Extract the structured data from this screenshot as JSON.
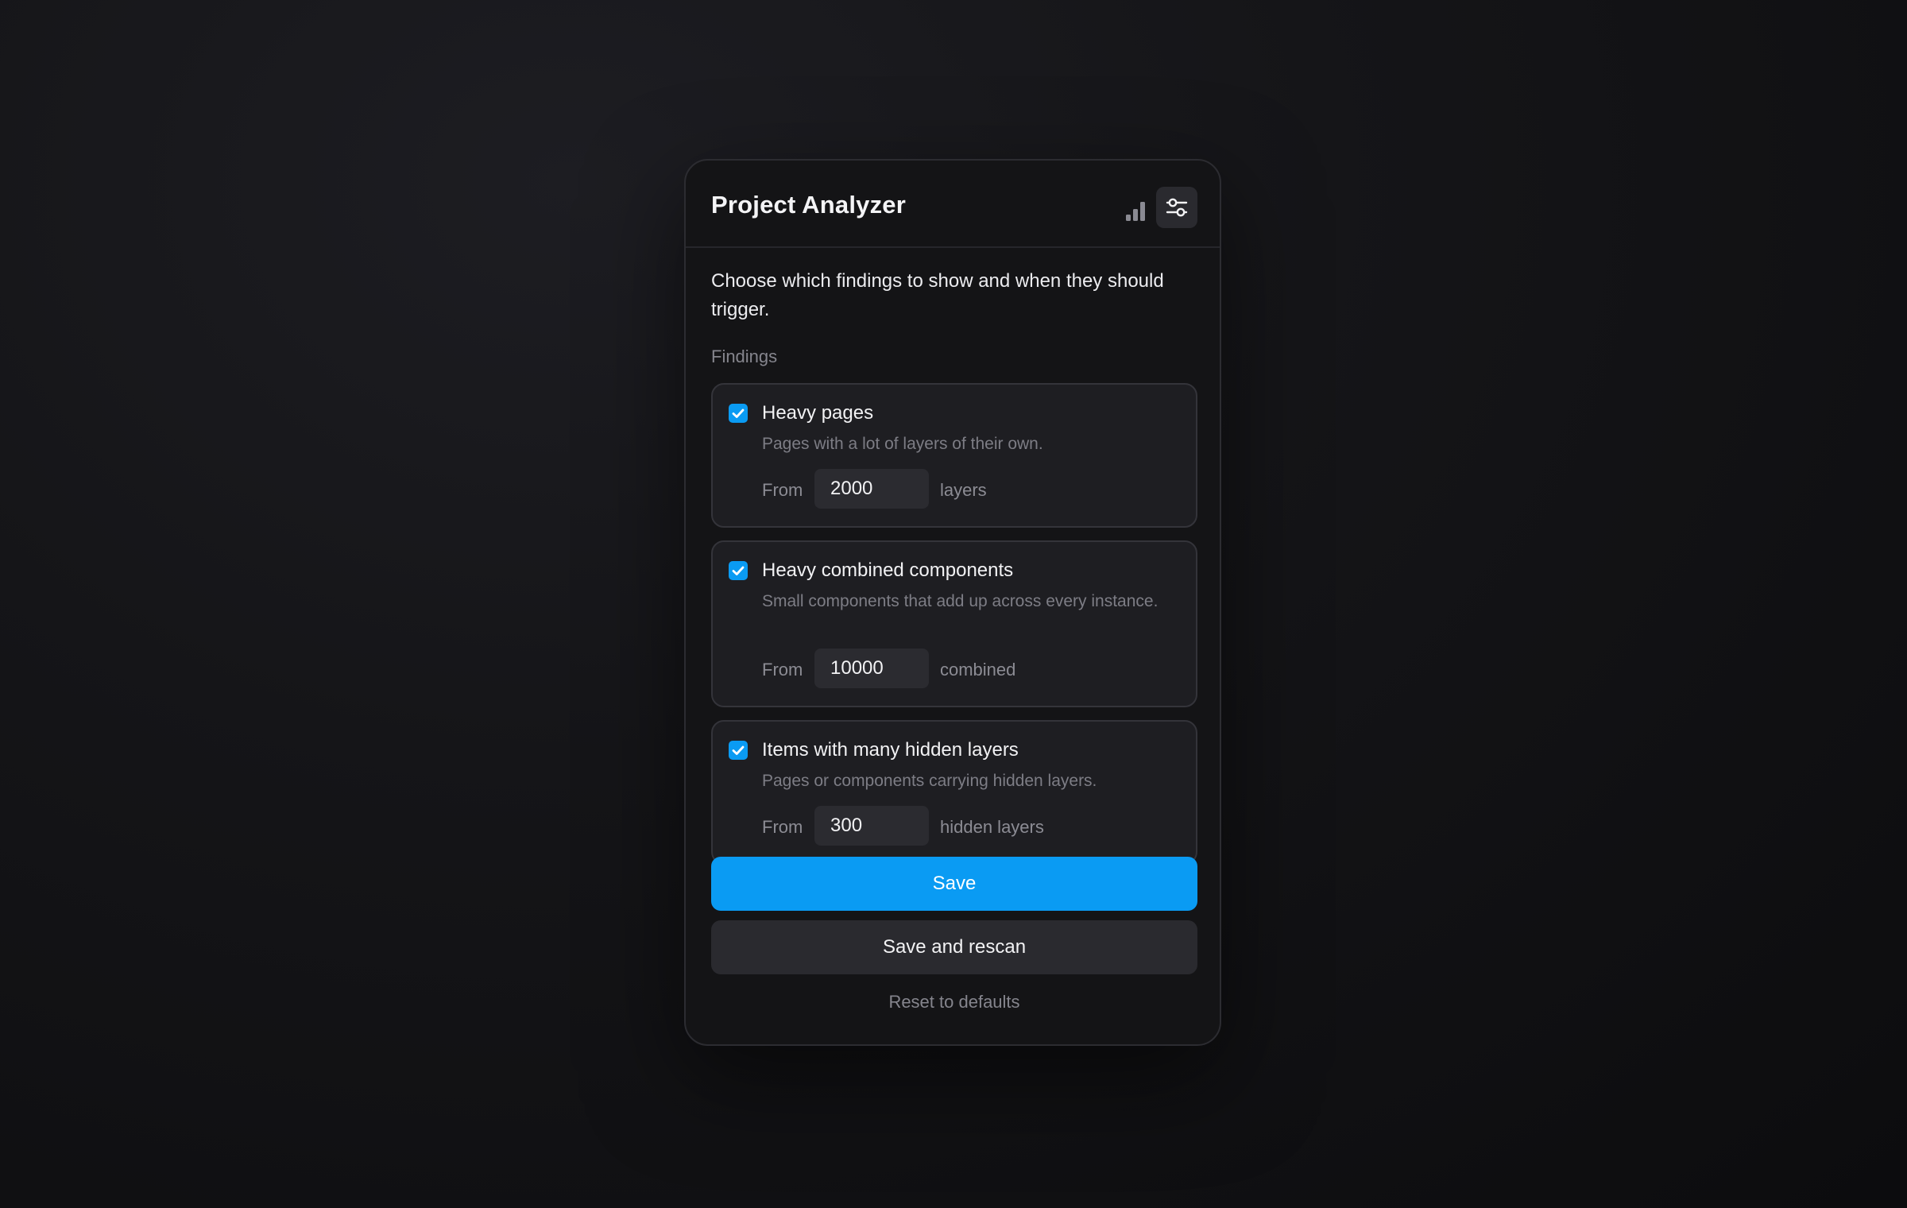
{
  "app": {
    "title": "Project Analyzer"
  },
  "header": {
    "stats_icon": "bar-chart-icon",
    "settings_icon": "sliders-icon"
  },
  "intro": {
    "text": "Choose which findings to show and when they should trigger."
  },
  "findings": {
    "label": "Findings",
    "items": [
      {
        "title": "Heavy pages",
        "description": "Pages with a lot of layers of their own.",
        "checked": true,
        "from_label": "From",
        "value": "2000",
        "unit": "layers"
      },
      {
        "title": "Heavy combined components",
        "description": "Small components that add up across every instance.",
        "checked": true,
        "from_label": "From",
        "value": "10000",
        "unit": "combined"
      },
      {
        "title": "Items with many hidden layers",
        "description": "Pages or components carrying hidden layers.",
        "checked": true,
        "from_label": "From",
        "value": "300",
        "unit": "hidden layers"
      }
    ]
  },
  "actions": {
    "save_label": "Save",
    "save_rescan_label": "Save and rescan",
    "reset_label": "Reset to defaults"
  },
  "colors": {
    "accent": "#0a9bf3",
    "panel": "#141416",
    "card": "#1e1e22"
  }
}
